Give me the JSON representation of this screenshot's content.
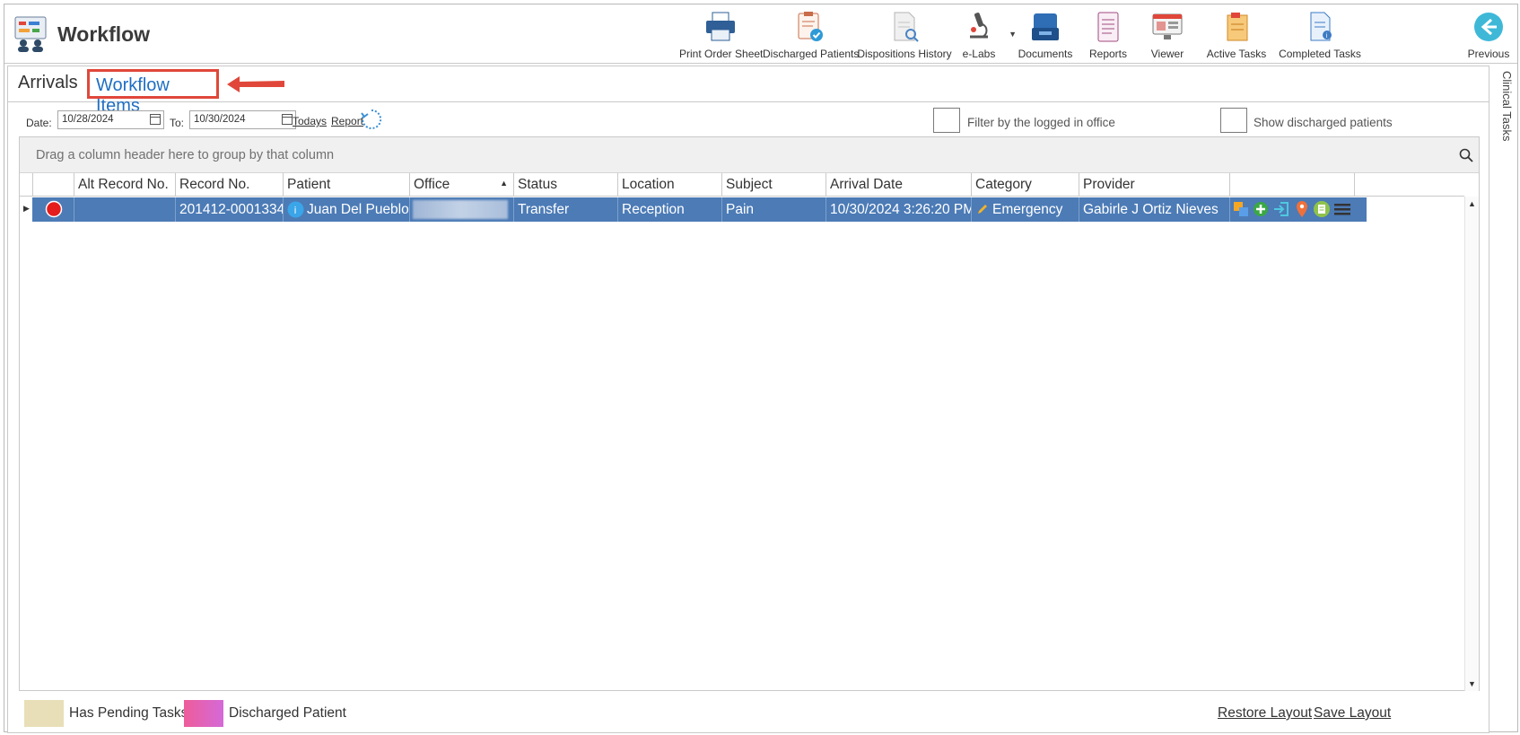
{
  "app": {
    "title": "Workflow"
  },
  "toolbar": {
    "items": [
      {
        "label": "Print Order Sheet",
        "icon": "printer-icon"
      },
      {
        "label": "Discharged Patients",
        "icon": "clipboard-check-icon"
      },
      {
        "label": "Dispositions History",
        "icon": "document-search-icon"
      },
      {
        "label": "e-Labs",
        "icon": "microscope-icon"
      },
      {
        "label": "Documents",
        "icon": "inbox-tray-icon"
      },
      {
        "label": "Reports",
        "icon": "report-clipboard-icon"
      },
      {
        "label": "Viewer",
        "icon": "monitor-viewer-icon"
      },
      {
        "label": "Active Tasks",
        "icon": "active-tasks-icon"
      },
      {
        "label": "Completed Tasks",
        "icon": "completed-tasks-icon"
      },
      {
        "label": "Previous",
        "icon": "back-arrow-icon"
      }
    ]
  },
  "tabs": {
    "arrivals": "Arrivals",
    "workflow_items": "Workflow Items"
  },
  "filters": {
    "date_label": "Date:",
    "date_from": "10/28/2024",
    "to_label": "To:",
    "date_to": "10/30/2024",
    "todays_link": "Todays",
    "report_link": "Report",
    "filter_office_label": "Filter by the logged in office",
    "show_discharged_label": "Show discharged patients"
  },
  "grid": {
    "group_panel_text": "Drag a column header here to group by that column",
    "columns": [
      "",
      "Alt Record No.",
      "Record No.",
      "Patient",
      "Office",
      "Status",
      "Location",
      "Subject",
      "Arrival Date",
      "Category",
      "Provider",
      ""
    ],
    "rows": [
      {
        "alt_record_no": "",
        "record_no": "201412-0001334",
        "patient": "Juan Del Pueblo",
        "office": "",
        "status": "Transfer",
        "location": "Reception",
        "subject": "Pain",
        "arrival_date": "10/30/2024 3:26:20 PM",
        "category": "Emergency",
        "provider": "Gabirle J Ortiz Nieves"
      }
    ]
  },
  "legend": {
    "pending_label": "Has Pending Tasks",
    "pending_color": "#e8dfb8",
    "discharged_label": "Discharged Patient",
    "discharged_color": "#e05fa8",
    "restore_layout": "Restore Layout",
    "save_layout": "Save Layout"
  },
  "side_panel": {
    "label": "Clinical Tasks"
  },
  "colors": {
    "accent": "#1f6fc2",
    "selected_row": "#4c7bb6",
    "highlight_box": "#e0473a"
  }
}
